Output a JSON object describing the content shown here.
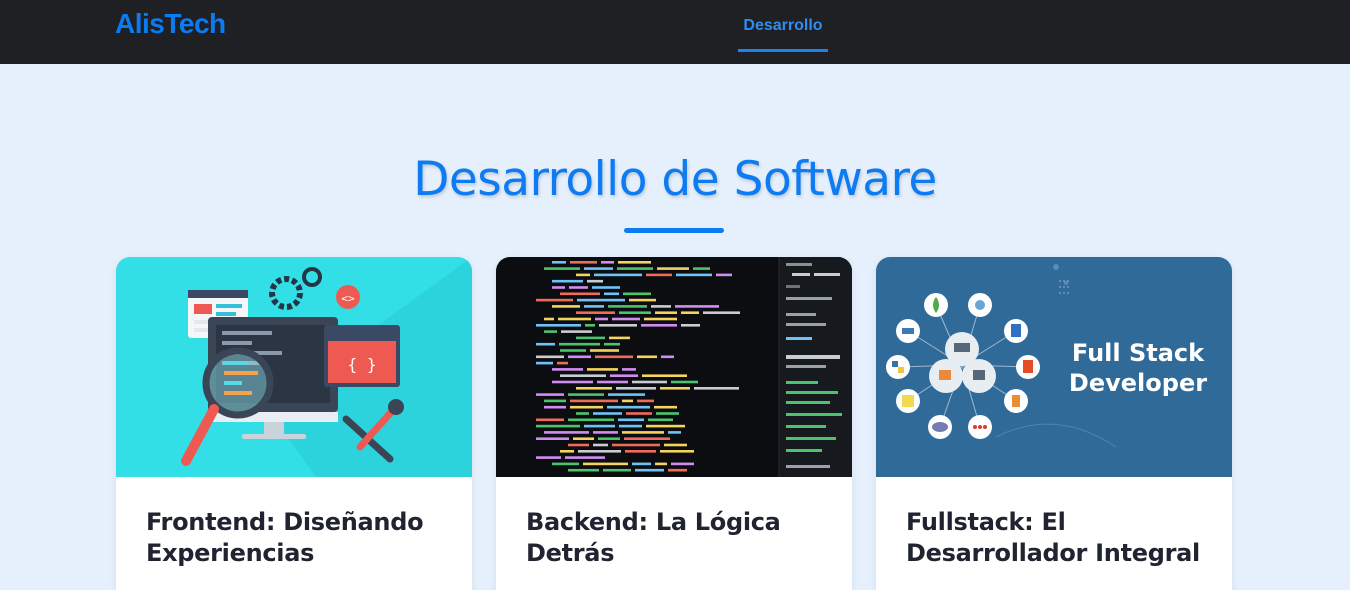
{
  "navbar": {
    "brand": "AlisTech",
    "links": [
      {
        "label": "Desarrollo",
        "active": true
      }
    ]
  },
  "section": {
    "title": "Desarrollo de Software"
  },
  "cards": [
    {
      "title_line1": "Frontend: Diseñando",
      "title_line2": "Experiencias",
      "image": "frontend-illustration"
    },
    {
      "title_line1": "Backend: La Lógica",
      "title_line2": "Detrás",
      "image": "code-editor-screenshot"
    },
    {
      "title_line1": "Fullstack: El",
      "title_line2": "Desarrollador Integral",
      "image": "fullstack-diagram",
      "image_text_line1": "Full Stack",
      "image_text_line2": "Developer"
    }
  ],
  "colors": {
    "navbar_bg": "#1e2024",
    "accent": "#0d7cf2",
    "page_bg": "#e6f0fd",
    "card_bg": "#ffffff",
    "card_title": "#1f2430"
  }
}
